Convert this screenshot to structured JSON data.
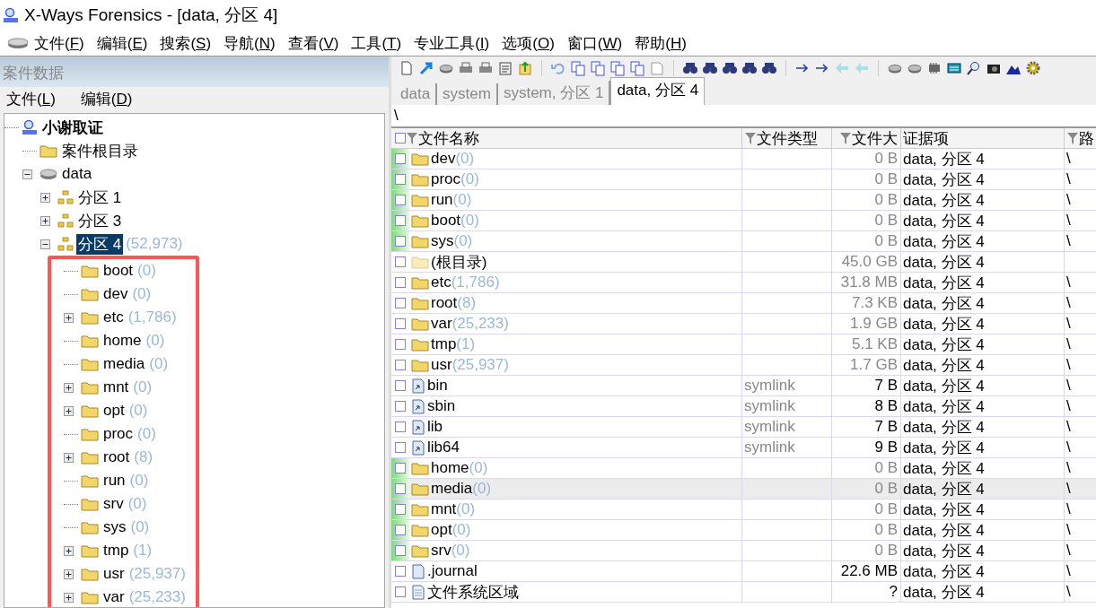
{
  "window": {
    "title": "X-Ways Forensics - [data, 分区 4]"
  },
  "menu": [
    "文件(F)",
    "编辑(E)",
    "搜索(S)",
    "导航(N)",
    "查看(V)",
    "工具(T)",
    "专业工具(I)",
    "选项(O)",
    "窗口(W)",
    "帮助(H)"
  ],
  "case_panel": {
    "title": "案件数据",
    "menu": [
      "文件(L)",
      "编辑(D)"
    ],
    "tree": [
      {
        "label": "小谢取证",
        "kind": "case",
        "selected": false,
        "children": [
          {
            "label": "案件根目录",
            "kind": "folder",
            "selected": false
          },
          {
            "label": "data",
            "kind": "disk",
            "expanded": true,
            "selected": false,
            "children": [
              {
                "label": "分区 1",
                "kind": "partition",
                "expanded": false,
                "selected": false
              },
              {
                "label": "分区 3",
                "kind": "partition",
                "expanded": false,
                "selected": false
              },
              {
                "label": "分区 4",
                "count": "(52,973)",
                "kind": "partition",
                "expanded": true,
                "selected": true,
                "highlighted": true,
                "children": [
                  {
                    "label": "boot",
                    "count": "(0)",
                    "kind": "folder",
                    "selected": false
                  },
                  {
                    "label": "dev",
                    "count": "(0)",
                    "kind": "folder",
                    "selected": false
                  },
                  {
                    "label": "etc",
                    "count": "(1,786)",
                    "kind": "folder",
                    "expanded": false,
                    "selected": false
                  },
                  {
                    "label": "home",
                    "count": "(0)",
                    "kind": "folder",
                    "selected": false
                  },
                  {
                    "label": "media",
                    "count": "(0)",
                    "kind": "folder",
                    "selected": false
                  },
                  {
                    "label": "mnt",
                    "count": "(0)",
                    "kind": "folder",
                    "expanded": false,
                    "selected": false
                  },
                  {
                    "label": "opt",
                    "count": "(0)",
                    "kind": "folder",
                    "expanded": false,
                    "selected": false
                  },
                  {
                    "label": "proc",
                    "count": "(0)",
                    "kind": "folder",
                    "selected": false
                  },
                  {
                    "label": "root",
                    "count": "(8)",
                    "kind": "folder",
                    "expanded": false,
                    "selected": false
                  },
                  {
                    "label": "run",
                    "count": "(0)",
                    "kind": "folder",
                    "selected": false
                  },
                  {
                    "label": "srv",
                    "count": "(0)",
                    "kind": "folder",
                    "selected": false
                  },
                  {
                    "label": "sys",
                    "count": "(0)",
                    "kind": "folder",
                    "selected": false
                  },
                  {
                    "label": "tmp",
                    "count": "(1)",
                    "kind": "folder",
                    "expanded": false,
                    "selected": false
                  },
                  {
                    "label": "usr",
                    "count": "(25,937)",
                    "kind": "folder",
                    "expanded": false,
                    "selected": false
                  },
                  {
                    "label": "var",
                    "count": "(25,233)",
                    "kind": "folder",
                    "expanded": false,
                    "selected": false
                  }
                ]
              }
            ]
          }
        ]
      }
    ]
  },
  "tabs": [
    {
      "label": "data",
      "selected": false
    },
    {
      "label": "system",
      "selected": false
    },
    {
      "label": "system, 分区 1",
      "selected": false
    },
    {
      "label": "data, 分区 4",
      "selected": true
    }
  ],
  "path": "\\",
  "table": {
    "select_all": false,
    "columns": [
      "文件名称",
      "文件类型",
      "文件大",
      "证据项",
      "路"
    ],
    "rows": [
      {
        "name": "dev",
        "count": "(0)",
        "kind": "folder",
        "size": "0 B",
        "evidence": "data, 分区 4",
        "path": "\\",
        "marked": true,
        "selected": false
      },
      {
        "name": "proc",
        "count": "(0)",
        "kind": "folder",
        "size": "0 B",
        "evidence": "data, 分区 4",
        "path": "\\",
        "marked": true,
        "selected": false
      },
      {
        "name": "run",
        "count": "(0)",
        "kind": "folder",
        "size": "0 B",
        "evidence": "data, 分区 4",
        "path": "\\",
        "marked": true,
        "selected": false
      },
      {
        "name": "boot",
        "count": "(0)",
        "kind": "folder",
        "size": "0 B",
        "evidence": "data, 分区 4",
        "path": "\\",
        "marked": true,
        "selected": false
      },
      {
        "name": "sys",
        "count": "(0)",
        "kind": "folder",
        "size": "0 B",
        "evidence": "data, 分区 4",
        "path": "\\",
        "marked": true,
        "selected": false
      },
      {
        "name": "(根目录)",
        "kind": "root",
        "size": "45.0 GB",
        "evidence": "data, 分区 4",
        "marked": false,
        "selected": false
      },
      {
        "name": "etc",
        "count": "(1,786)",
        "kind": "folder",
        "size": "31.8 MB",
        "evidence": "data, 分区 4",
        "path": "\\",
        "marked": false,
        "selected": false
      },
      {
        "name": "root",
        "count": "(8)",
        "kind": "folder",
        "size": "7.3 KB",
        "evidence": "data, 分区 4",
        "path": "\\",
        "marked": false,
        "selected": false
      },
      {
        "name": "var",
        "count": "(25,233)",
        "kind": "folder",
        "size": "1.9 GB",
        "evidence": "data, 分区 4",
        "path": "\\",
        "marked": false,
        "selected": false
      },
      {
        "name": "tmp",
        "count": "(1)",
        "kind": "folder",
        "size": "5.1 KB",
        "evidence": "data, 分区 4",
        "path": "\\",
        "marked": false,
        "selected": false
      },
      {
        "name": "usr",
        "count": "(25,937)",
        "kind": "folder",
        "size": "1.7 GB",
        "evidence": "data, 分区 4",
        "path": "\\",
        "marked": false,
        "selected": false
      },
      {
        "name": "bin",
        "kind": "symlink",
        "type": "symlink",
        "size": "7 B",
        "evidence": "data, 分区 4",
        "path": "\\",
        "marked": false,
        "selected": false
      },
      {
        "name": "sbin",
        "kind": "symlink",
        "type": "symlink",
        "size": "8 B",
        "evidence": "data, 分区 4",
        "path": "\\",
        "marked": false,
        "selected": false
      },
      {
        "name": "lib",
        "kind": "symlink",
        "type": "symlink",
        "size": "7 B",
        "evidence": "data, 分区 4",
        "path": "\\",
        "marked": false,
        "selected": false
      },
      {
        "name": "lib64",
        "kind": "symlink",
        "type": "symlink",
        "size": "9 B",
        "evidence": "data, 分区 4",
        "path": "\\",
        "marked": false,
        "selected": false
      },
      {
        "name": "home",
        "count": "(0)",
        "kind": "folder",
        "size": "0 B",
        "evidence": "data, 分区 4",
        "path": "\\",
        "marked": true,
        "selected": false
      },
      {
        "name": "media",
        "count": "(0)",
        "kind": "folder",
        "size": "0 B",
        "evidence": "data, 分区 4",
        "path": "\\",
        "marked": true,
        "selected": true
      },
      {
        "name": "mnt",
        "count": "(0)",
        "kind": "folder",
        "size": "0 B",
        "evidence": "data, 分区 4",
        "path": "\\",
        "marked": true,
        "selected": false
      },
      {
        "name": "opt",
        "count": "(0)",
        "kind": "folder",
        "size": "0 B",
        "evidence": "data, 分区 4",
        "path": "\\",
        "marked": true,
        "selected": false
      },
      {
        "name": "srv",
        "count": "(0)",
        "kind": "folder",
        "size": "0 B",
        "evidence": "data, 分区 4",
        "path": "\\",
        "marked": true,
        "selected": false
      },
      {
        "name": ".journal",
        "kind": "file",
        "size": "22.6 MB",
        "evidence": "data, 分区 4",
        "path": "\\",
        "marked": false,
        "selected": false
      },
      {
        "name": "文件系统区域",
        "kind": "region",
        "size": "?",
        "evidence": "data, 分区 4",
        "path": "\\",
        "marked": false,
        "selected": false
      }
    ]
  }
}
